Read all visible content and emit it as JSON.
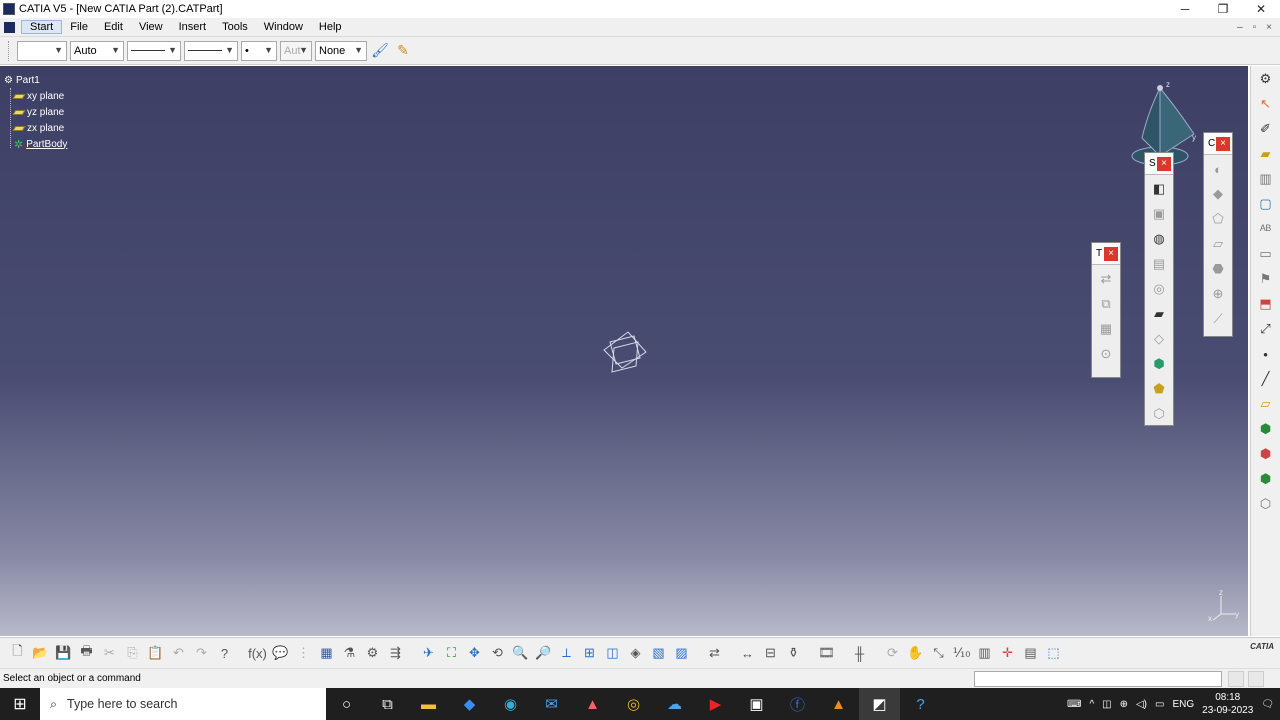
{
  "window": {
    "title": "CATIA V5 - [New CATIA Part (2).CATPart]",
    "minimize": "─",
    "maximize": "❐",
    "close": "✕"
  },
  "menu": {
    "items": [
      "Start",
      "File",
      "Edit",
      "View",
      "Insert",
      "Tools",
      "Window",
      "Help"
    ],
    "active": "Start"
  },
  "properties_toolbar": {
    "color_value": "",
    "transparency_value": "Auto",
    "point_value": "•",
    "layer_disabled": "Aut",
    "layer_value": "None"
  },
  "tree": {
    "root": "Part1",
    "children": [
      "xy plane",
      "yz plane",
      "zx plane"
    ],
    "body": "PartBody"
  },
  "floating_toolbars": {
    "t_label": "T",
    "s_label": "S",
    "c_label": "C",
    "close": "×"
  },
  "compass": {
    "z_label": "z",
    "y_label": "y"
  },
  "mini_axis": {
    "z": "z",
    "x": "x",
    "y": "y"
  },
  "catia_logo": "CATIA",
  "status": {
    "text": "Select an object or a command"
  },
  "taskbar": {
    "search_placeholder": "Type here to search",
    "lang": "ENG",
    "time": "08:18",
    "date": "23-09-2023"
  },
  "colors": {
    "viewport_top": "#3d3f64",
    "viewport_bottom": "#b8b9c9",
    "close_red": "#d9382c"
  }
}
